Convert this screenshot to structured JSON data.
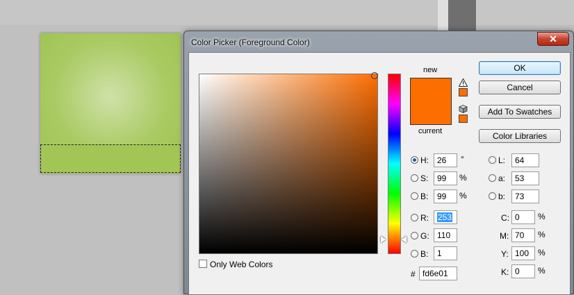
{
  "dialog": {
    "title": "Color Picker (Foreground Color)",
    "close_glyph": "✕"
  },
  "swatches": {
    "new_label": "new",
    "current_label": "current",
    "new_color": "#fd6e01",
    "current_color": "#fd6e01"
  },
  "buttons": {
    "ok": "OK",
    "cancel": "Cancel",
    "add_to_swatches": "Add To Swatches",
    "color_libraries": "Color Libraries"
  },
  "hsb": {
    "h": {
      "label": "H:",
      "value": "26",
      "unit": "°",
      "selected": true
    },
    "s": {
      "label": "S:",
      "value": "99",
      "unit": "%"
    },
    "b": {
      "label": "B:",
      "value": "99",
      "unit": "%"
    }
  },
  "rgb": {
    "r": {
      "label": "R:",
      "value": "253"
    },
    "g": {
      "label": "G:",
      "value": "110"
    },
    "b": {
      "label": "B:",
      "value": "1"
    }
  },
  "lab": {
    "l": {
      "label": "L:",
      "value": "64"
    },
    "a": {
      "label": "a:",
      "value": "53"
    },
    "b": {
      "label": "b:",
      "value": "73"
    }
  },
  "cmyk": {
    "c": {
      "label": "C:",
      "value": "0",
      "unit": "%"
    },
    "m": {
      "label": "M:",
      "value": "70",
      "unit": "%"
    },
    "y": {
      "label": "Y:",
      "value": "100",
      "unit": "%"
    },
    "k": {
      "label": "K:",
      "value": "0",
      "unit": "%"
    }
  },
  "hex": {
    "label": "#",
    "value": "fd6e01"
  },
  "web_colors": {
    "label": "Only Web Colors",
    "checked": false
  },
  "icons": {
    "gamut_warning": "warning-triangle-icon",
    "web_safe_warning": "cube-icon"
  },
  "colors": {
    "foreground": "#fd6e01",
    "document_green": "#a2c556"
  }
}
